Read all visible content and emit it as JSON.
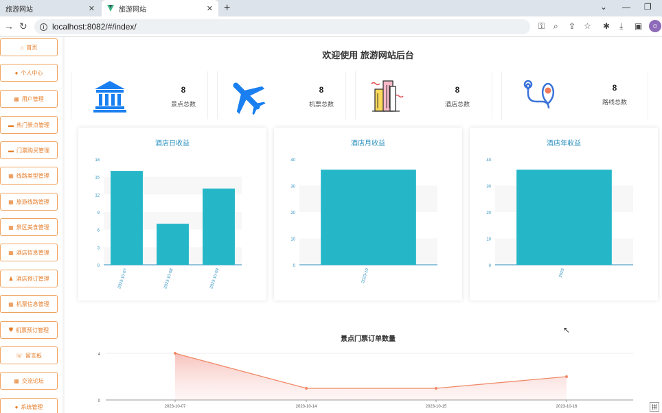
{
  "browser": {
    "tabs": [
      {
        "title": "旅游网站",
        "active": false
      },
      {
        "title": "旅游网站",
        "active": true
      }
    ],
    "url": "localhost:8082/#/index/"
  },
  "sidebar": {
    "items": [
      {
        "label": "首页",
        "icon": "home-icon"
      },
      {
        "label": "个人中心",
        "icon": "user-icon"
      },
      {
        "label": "用户管理",
        "icon": "users-icon"
      },
      {
        "label": "热门景点管理",
        "icon": "folder-icon"
      },
      {
        "label": "门票购买管理",
        "icon": "folder-icon"
      },
      {
        "label": "线路类型管理",
        "icon": "grid-icon"
      },
      {
        "label": "旅游线路管理",
        "icon": "grid-icon"
      },
      {
        "label": "景区美食管理",
        "icon": "grid-icon"
      },
      {
        "label": "酒店信息管理",
        "icon": "grid-icon"
      },
      {
        "label": "酒店预订管理",
        "icon": "person-icon"
      },
      {
        "label": "机票信息管理",
        "icon": "grid-icon"
      },
      {
        "label": "机票预订管理",
        "icon": "shield-icon"
      },
      {
        "label": "留言板",
        "icon": "message-icon"
      },
      {
        "label": "交流论坛",
        "icon": "grid-icon"
      },
      {
        "label": "系统管理",
        "icon": "location-icon"
      }
    ]
  },
  "main": {
    "title": "欢迎使用 旅游网站后台",
    "stats": [
      {
        "value": "8",
        "label": "景点总数",
        "icon": "temple-icon"
      },
      {
        "value": "8",
        "label": "机票总数",
        "icon": "airplane-icon"
      },
      {
        "value": "8",
        "label": "酒店总数",
        "icon": "buildings-icon"
      },
      {
        "value": "8",
        "label": "路线总数",
        "icon": "route-icon"
      }
    ]
  },
  "chart_data": [
    {
      "type": "bar",
      "title": "酒店日收益",
      "categories": [
        "2023-10-07",
        "2023-10-08",
        "2023-10-09"
      ],
      "values": [
        16,
        7,
        13
      ],
      "ylim": [
        0,
        18
      ],
      "yticks": [
        0,
        3,
        6,
        9,
        12,
        15,
        18
      ],
      "color": "#25b7c8"
    },
    {
      "type": "bar",
      "title": "酒店月收益",
      "categories": [
        "2023-10"
      ],
      "values": [
        36
      ],
      "ylim": [
        0,
        40
      ],
      "yticks": [
        0,
        10,
        20,
        30,
        40
      ],
      "color": "#25b7c8"
    },
    {
      "type": "bar",
      "title": "酒店年收益",
      "categories": [
        "2023"
      ],
      "values": [
        36
      ],
      "ylim": [
        0,
        40
      ],
      "yticks": [
        0,
        10,
        20,
        30,
        40
      ],
      "color": "#25b7c8"
    },
    {
      "type": "area",
      "title": "景点门票订单数量",
      "categories": [
        "2023-10-07",
        "2023-10-14",
        "2023-10-15",
        "2023-10-16"
      ],
      "values": [
        4,
        1,
        1,
        2
      ],
      "ylim": [
        0,
        4
      ],
      "yticks": [
        0,
        4
      ],
      "color": "#ef8a68"
    }
  ]
}
